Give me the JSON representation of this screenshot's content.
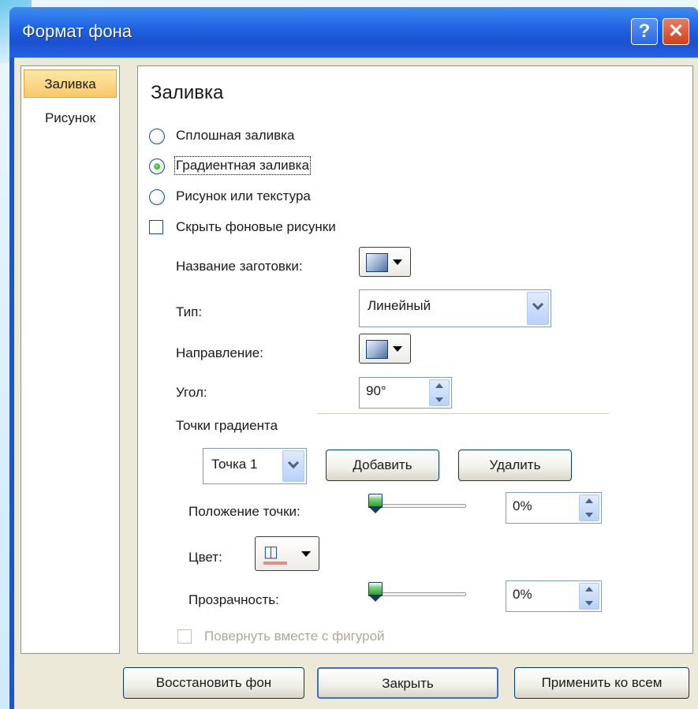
{
  "window": {
    "title": "Формат фона",
    "help_label": "?",
    "close_label": "✕"
  },
  "sidebar": {
    "items": [
      {
        "label": "Заливка",
        "active": true
      },
      {
        "label": "Рисунок",
        "active": false
      }
    ]
  },
  "fill": {
    "heading": "Заливка",
    "options": [
      {
        "label": "Сплошная заливка",
        "checked": false
      },
      {
        "label": "Градиентная заливка",
        "checked": true
      },
      {
        "label": "Рисунок или текстура",
        "checked": false
      }
    ],
    "hide_bg": {
      "label": "Скрыть фоновые рисунки",
      "checked": false
    }
  },
  "gradient": {
    "preset_label": "Название заготовки:",
    "type_label": "Тип:",
    "type_value": "Линейный",
    "direction_label": "Направление:",
    "angle_label": "Угол:",
    "angle_value": "90°",
    "stops_label": "Точки градиента",
    "stop_value": "Точка 1",
    "add_label": "Добавить",
    "remove_label": "Удалить",
    "position_label": "Положение точки:",
    "position_value": "0%",
    "position_fraction": 0.0,
    "color_label": "Цвет:",
    "transparency_label": "Прозрачность:",
    "transparency_value": "0%",
    "transparency_fraction": 0.0,
    "rotate_label": "Повернуть вместе с фигурой",
    "rotate_enabled": false
  },
  "footer": {
    "reset_label": "Восстановить фон",
    "close_label": "Закрыть",
    "apply_all_label": "Применить ко всем"
  },
  "colors": {
    "titlebar": "#1f5fe0",
    "active_tab": "#f8c86a",
    "color_swatch": "#e78c7e",
    "dialog_bg": "#ece9d8"
  }
}
